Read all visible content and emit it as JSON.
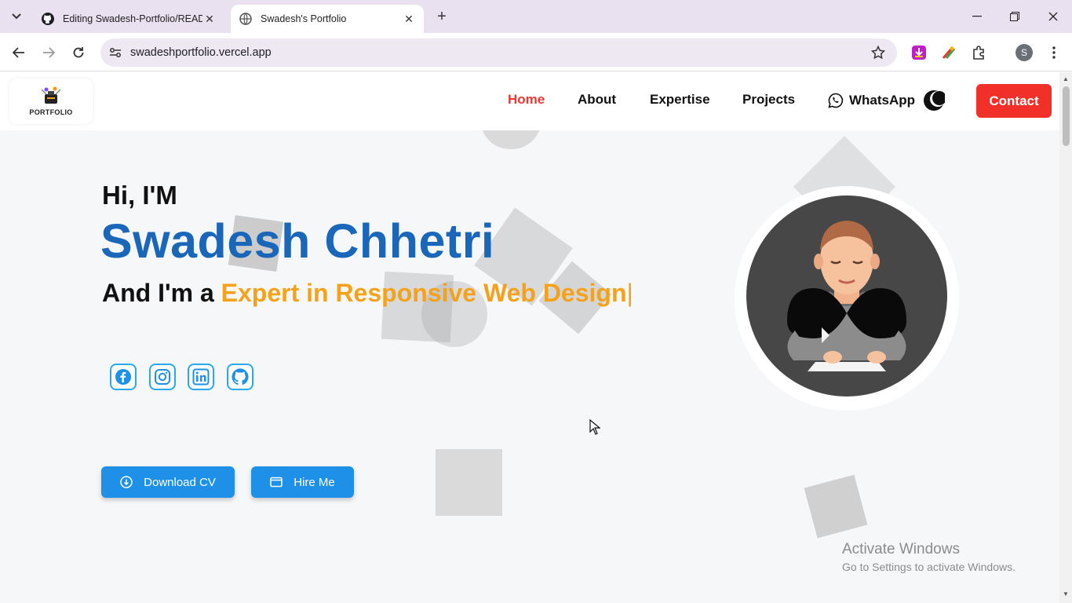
{
  "browser": {
    "tabs": [
      {
        "title": "Editing Swadesh-Portfolio/READM",
        "icon": "github-icon",
        "active": false
      },
      {
        "title": "Swadesh's Portfolio",
        "icon": "globe-icon",
        "active": true
      }
    ],
    "url": "swadeshportfolio.vercel.app",
    "profile_initial": "S"
  },
  "header": {
    "logo_text": "PORTFOLIO",
    "nav": {
      "home": "Home",
      "about": "About",
      "expertise": "Expertise",
      "projects": "Projects",
      "whatsapp": "WhatsApp"
    },
    "contact_label": "Contact",
    "active_color": "#e53935",
    "contact_color": "#f03029"
  },
  "hero": {
    "greeting": "Hi, I'M",
    "name": "Swadesh Chhetri",
    "tagline_prefix": "And I'm a ",
    "tagline_role": "Expert in Responsive Web Design",
    "caret": "|",
    "social": [
      "facebook-icon",
      "instagram-icon",
      "linkedin-icon",
      "github-icon"
    ],
    "download_cv_label": "Download CV",
    "hire_me_label": "Hire Me",
    "name_color": "#1a66b8",
    "role_color": "#f4a21a",
    "button_color": "#1e90e8"
  },
  "watermark": {
    "line1": "Activate Windows",
    "line2": "Go to Settings to activate Windows."
  }
}
